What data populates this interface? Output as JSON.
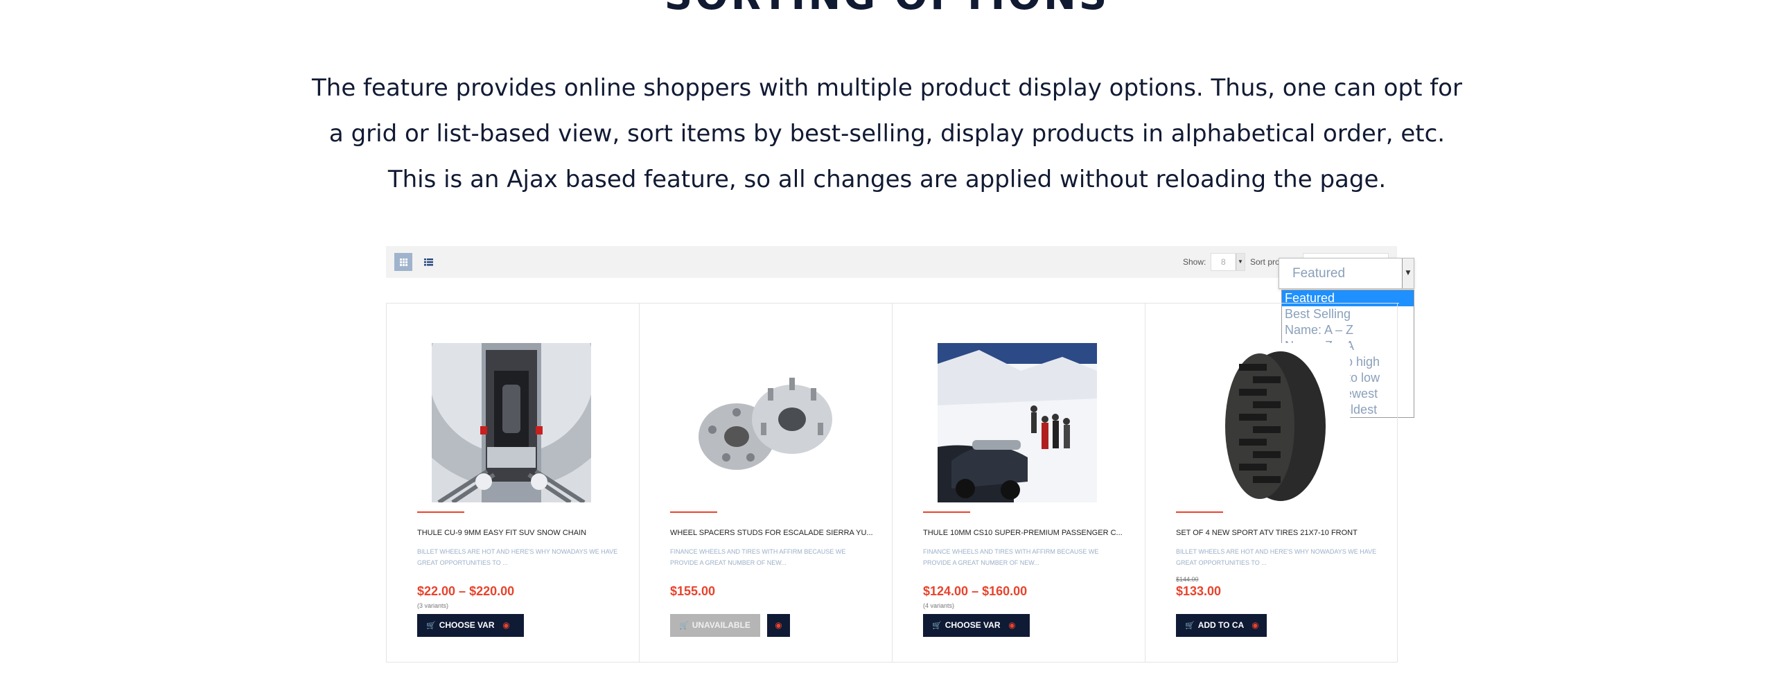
{
  "header": {
    "title": "SORTING OPTIONS",
    "description": [
      "The feature provides online shoppers with multiple product display options. Thus, one can opt for",
      "a grid or list-based view, sort items by best-selling, display products in alphabetical order, etc.",
      "This is an Ajax based feature, so all changes are applied without reloading the page."
    ]
  },
  "toolbar": {
    "grid_view_icon": "grid-icon",
    "list_view_icon": "list-icon",
    "show_label": "Show:",
    "show_value": "8",
    "sort_label": "Sort pro",
    "sort_value": "Featured",
    "sort_options": [
      "Featured",
      "Best Selling",
      "Name: A – Z",
      "Name: Z – A",
      "Price: low to high",
      "Price: high to low",
      "Oldest to newest",
      "Newest to oldest"
    ],
    "selected_option": "Featured"
  },
  "products": [
    {
      "title": "THULE CU-9 9MM EASY FIT SUV SNOW CHAIN",
      "description": "BILLET WHEELS ARE HOT AND HERE'S WHY NOWADAYS WE HAVE GREAT OPPORTUNITIES TO ...",
      "old_price": "",
      "price": "$22.00 – $220.00",
      "variants": "(3 variants)",
      "button": "CHOOSE VARIANT"
    },
    {
      "title": "WHEEL SPACERS STUDS FOR ESCALADE SIERRA YU...",
      "description": "FINANCE WHEELS AND TIRES WITH AFFIRM BECAUSE WE PROVIDE A GREAT NUMBER OF NEW...",
      "old_price": "",
      "price": "$155.00",
      "variants": "",
      "button": "UNAVAILABLE"
    },
    {
      "title": "THULE 10MM CS10 SUPER-PREMIUM PASSENGER C...",
      "description": "FINANCE WHEELS AND TIRES WITH AFFIRM BECAUSE WE PROVIDE A GREAT NUMBER OF NEW...",
      "old_price": "",
      "price": "$124.00 – $160.00",
      "variants": "(4 variants)",
      "button": "CHOOSE VARIANT"
    },
    {
      "title": "SET OF 4 NEW SPORT ATV TIRES 21X7-10 FRONT",
      "description": "BILLET WHEELS ARE HOT AND HERE'S WHY NOWADAYS WE HAVE GREAT OPPORTUNITIES TO ...",
      "old_price": "$144.00",
      "price": "$133.00",
      "variants": "",
      "button": "ADD TO CART"
    }
  ],
  "icons": {
    "cart": "cart-icon",
    "quick_view": "eye-icon"
  },
  "colors": {
    "accent": "#e8432c",
    "navy": "#0f1a35",
    "selected": "#1e90ff",
    "muted_text": "#9bb0c8"
  }
}
